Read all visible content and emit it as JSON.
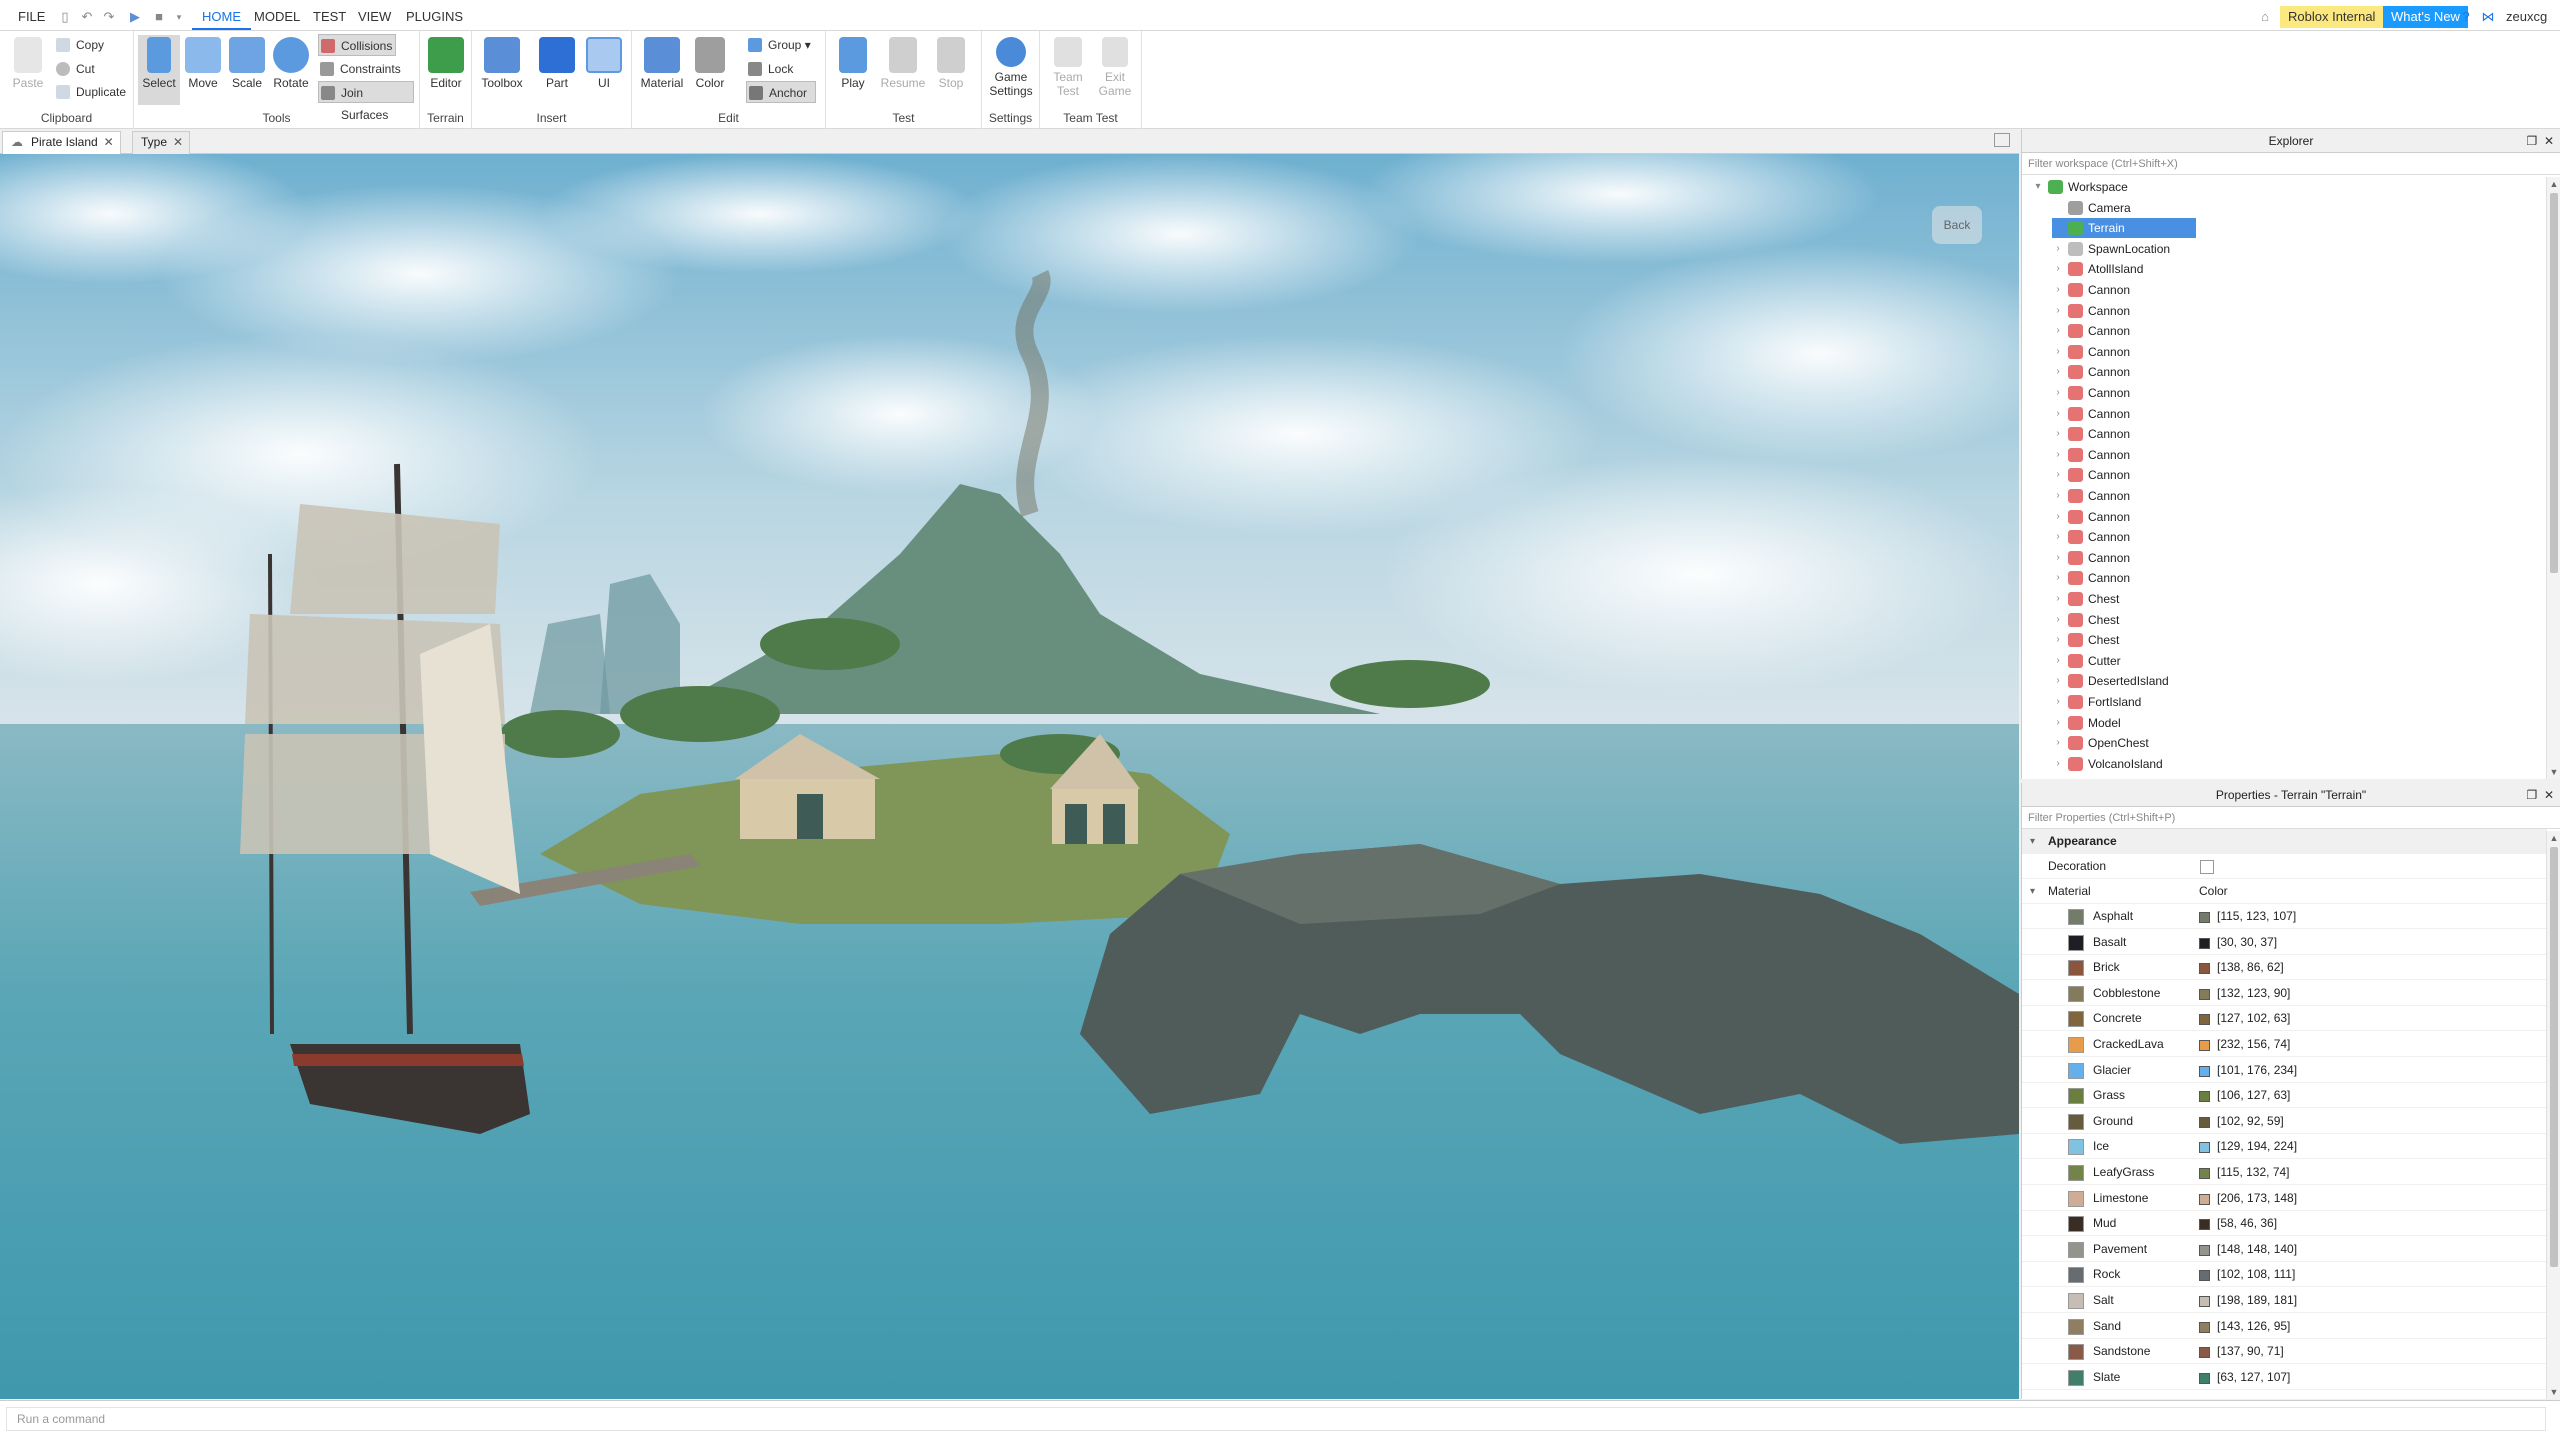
{
  "menubar": {
    "file": "FILE",
    "tabs": [
      "HOME",
      "MODEL",
      "TEST",
      "VIEW",
      "PLUGINS"
    ],
    "active_tab": "HOME",
    "roblox_internal": "Roblox Internal",
    "whats_new": "What's New",
    "username": "zeuxcg"
  },
  "ribbon": {
    "clipboard": {
      "label": "Clipboard",
      "paste": "Paste",
      "copy": "Copy",
      "cut": "Cut",
      "duplicate": "Duplicate"
    },
    "tools": {
      "label": "Tools",
      "select": "Select",
      "move": "Move",
      "scale": "Scale",
      "rotate": "Rotate",
      "collisions": "Collisions",
      "constraints": "Constraints",
      "join_surfaces": "Join Surfaces"
    },
    "terrain": {
      "label": "Terrain",
      "editor": "Editor"
    },
    "insert": {
      "label": "Insert",
      "toolbox": "Toolbox",
      "part": "Part",
      "ui": "UI"
    },
    "edit": {
      "label": "Edit",
      "material": "Material",
      "color": "Color",
      "group": "Group",
      "lock": "Lock",
      "anchor": "Anchor"
    },
    "test": {
      "label": "Test",
      "play": "Play",
      "resume": "Resume",
      "stop": "Stop"
    },
    "settings": {
      "label": "Settings",
      "game_settings_1": "Game",
      "game_settings_2": "Settings"
    },
    "team_test": {
      "label": "Team Test",
      "team_test_1": "Team",
      "team_test_2": "Test",
      "exit_game_1": "Exit",
      "exit_game_2": "Game"
    }
  },
  "doc_tabs": [
    {
      "label": "Pirate Island"
    },
    {
      "label": "Type"
    }
  ],
  "viewport": {
    "back": "Back"
  },
  "explorer": {
    "title": "Explorer",
    "filter_placeholder": "Filter workspace (Ctrl+Shift+X)",
    "items": [
      {
        "label": "Workspace",
        "depth": 0,
        "expandable": true,
        "expanded": true,
        "icon": "workspace-icon",
        "color": "#4caf50"
      },
      {
        "label": "Camera",
        "depth": 1,
        "expandable": false,
        "icon": "camera-icon",
        "color": "#9e9e9e"
      },
      {
        "label": "Terrain",
        "depth": 1,
        "expandable": false,
        "icon": "terrain-icon",
        "color": "#4caf50",
        "selected": true
      },
      {
        "label": "SpawnLocation",
        "depth": 1,
        "expandable": true,
        "icon": "spawn-icon",
        "color": "#bdbdbd"
      },
      {
        "label": "AtollIsland",
        "depth": 1,
        "expandable": true,
        "icon": "model-icon",
        "color": "#e57373"
      },
      {
        "label": "Cannon",
        "depth": 1,
        "expandable": true,
        "icon": "model-icon",
        "color": "#e57373"
      },
      {
        "label": "Cannon",
        "depth": 1,
        "expandable": true,
        "icon": "model-icon",
        "color": "#e57373"
      },
      {
        "label": "Cannon",
        "depth": 1,
        "expandable": true,
        "icon": "model-icon",
        "color": "#e57373"
      },
      {
        "label": "Cannon",
        "depth": 1,
        "expandable": true,
        "icon": "model-icon",
        "color": "#e57373"
      },
      {
        "label": "Cannon",
        "depth": 1,
        "expandable": true,
        "icon": "model-icon",
        "color": "#e57373"
      },
      {
        "label": "Cannon",
        "depth": 1,
        "expandable": true,
        "icon": "model-icon",
        "color": "#e57373"
      },
      {
        "label": "Cannon",
        "depth": 1,
        "expandable": true,
        "icon": "model-icon",
        "color": "#e57373"
      },
      {
        "label": "Cannon",
        "depth": 1,
        "expandable": true,
        "icon": "model-icon",
        "color": "#e57373"
      },
      {
        "label": "Cannon",
        "depth": 1,
        "expandable": true,
        "icon": "model-icon",
        "color": "#e57373"
      },
      {
        "label": "Cannon",
        "depth": 1,
        "expandable": true,
        "icon": "model-icon",
        "color": "#e57373"
      },
      {
        "label": "Cannon",
        "depth": 1,
        "expandable": true,
        "icon": "model-icon",
        "color": "#e57373"
      },
      {
        "label": "Cannon",
        "depth": 1,
        "expandable": true,
        "icon": "model-icon",
        "color": "#e57373"
      },
      {
        "label": "Cannon",
        "depth": 1,
        "expandable": true,
        "icon": "model-icon",
        "color": "#e57373"
      },
      {
        "label": "Cannon",
        "depth": 1,
        "expandable": true,
        "icon": "model-icon",
        "color": "#e57373"
      },
      {
        "label": "Cannon",
        "depth": 1,
        "expandable": true,
        "icon": "model-icon",
        "color": "#e57373"
      },
      {
        "label": "Chest",
        "depth": 1,
        "expandable": true,
        "icon": "model-icon",
        "color": "#e57373"
      },
      {
        "label": "Chest",
        "depth": 1,
        "expandable": true,
        "icon": "model-icon",
        "color": "#e57373"
      },
      {
        "label": "Chest",
        "depth": 1,
        "expandable": true,
        "icon": "model-icon",
        "color": "#e57373"
      },
      {
        "label": "Cutter",
        "depth": 1,
        "expandable": true,
        "icon": "model-icon",
        "color": "#e57373"
      },
      {
        "label": "DesertedIsland",
        "depth": 1,
        "expandable": true,
        "icon": "model-icon",
        "color": "#e57373"
      },
      {
        "label": "FortIsland",
        "depth": 1,
        "expandable": true,
        "icon": "model-icon",
        "color": "#e57373"
      },
      {
        "label": "Model",
        "depth": 1,
        "expandable": true,
        "icon": "model-icon",
        "color": "#e57373"
      },
      {
        "label": "OpenChest",
        "depth": 1,
        "expandable": true,
        "icon": "model-icon",
        "color": "#e57373"
      },
      {
        "label": "VolcanoIsland",
        "depth": 1,
        "expandable": true,
        "icon": "model-icon",
        "color": "#e57373"
      }
    ]
  },
  "properties": {
    "title": "Properties - Terrain \"Terrain\"",
    "filter_placeholder": "Filter Properties (Ctrl+Shift+P)",
    "section": "Appearance",
    "decoration_label": "Decoration",
    "material_label": "Material",
    "color_label": "Color",
    "materials": [
      {
        "name": "Asphalt",
        "rgb": "[115, 123, 107]",
        "hex": "#737b6b"
      },
      {
        "name": "Basalt",
        "rgb": "[30, 30, 37]",
        "hex": "#1e1e25"
      },
      {
        "name": "Brick",
        "rgb": "[138, 86, 62]",
        "hex": "#8a563e"
      },
      {
        "name": "Cobblestone",
        "rgb": "[132, 123, 90]",
        "hex": "#847b5a"
      },
      {
        "name": "Concrete",
        "rgb": "[127, 102, 63]",
        "hex": "#7f663f"
      },
      {
        "name": "CrackedLava",
        "rgb": "[232, 156, 74]",
        "hex": "#e89c4a"
      },
      {
        "name": "Glacier",
        "rgb": "[101, 176, 234]",
        "hex": "#65b0ea"
      },
      {
        "name": "Grass",
        "rgb": "[106, 127, 63]",
        "hex": "#6a7f3f"
      },
      {
        "name": "Ground",
        "rgb": "[102, 92, 59]",
        "hex": "#665c3b"
      },
      {
        "name": "Ice",
        "rgb": "[129, 194, 224]",
        "hex": "#81c2e0"
      },
      {
        "name": "LeafyGrass",
        "rgb": "[115, 132, 74]",
        "hex": "#73844a"
      },
      {
        "name": "Limestone",
        "rgb": "[206, 173, 148]",
        "hex": "#cead94"
      },
      {
        "name": "Mud",
        "rgb": "[58, 46, 36]",
        "hex": "#3a2e24"
      },
      {
        "name": "Pavement",
        "rgb": "[148, 148, 140]",
        "hex": "#94948c"
      },
      {
        "name": "Rock",
        "rgb": "[102, 108, 111]",
        "hex": "#666c6f"
      },
      {
        "name": "Salt",
        "rgb": "[198, 189, 181]",
        "hex": "#c6bdb5"
      },
      {
        "name": "Sand",
        "rgb": "[143, 126, 95]",
        "hex": "#8f7e5f"
      },
      {
        "name": "Sandstone",
        "rgb": "[137, 90, 71]",
        "hex": "#895a47"
      },
      {
        "name": "Slate",
        "rgb": "[63, 127, 107]",
        "hex": "#3f7f6b"
      }
    ]
  },
  "command_bar": {
    "placeholder": "Run a command"
  }
}
